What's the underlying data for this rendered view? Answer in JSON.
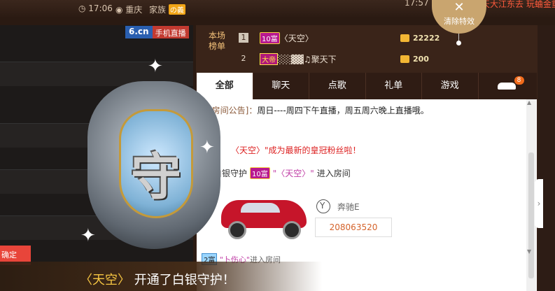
{
  "topbar": {
    "time": "17:06",
    "location": "重庆",
    "family_label": "家族",
    "family_badge": "の義",
    "right_time": "17:57",
    "ticker": "天大江东去 玩蛐金重"
  },
  "video": {
    "brand_site": "6.cn",
    "brand_tag": "手机直播",
    "confirm_label": "确定"
  },
  "leaderboard": {
    "label_line1": "本场",
    "label_line2": "榜单",
    "rows": [
      {
        "rank": "1",
        "badge": "10富",
        "name": "〈天空〉",
        "score": "22222"
      },
      {
        "rank": "2",
        "badge": "大帝",
        "name": "░░▓▓♫聚天下",
        "score": "200"
      }
    ]
  },
  "clear_effects": {
    "icon": "close-icon",
    "label": "清除特效"
  },
  "tabs": {
    "items": [
      "全部",
      "聊天",
      "点歌",
      "礼单",
      "游戏"
    ],
    "active": "全部",
    "car_badge": "8"
  },
  "chat": {
    "notice_label": "[房间公告]：",
    "notice_text": "周日----周四下午直播，周五周六晚上直播哦。",
    "msg1_name": "〈天空〉",
    "msg1_text": "\"成为最新的皇冠粉丝啦！",
    "msg2_prefix": "白银守护",
    "msg2_badge": "10富",
    "msg2_name": "\"〈天空〉\"",
    "msg2_text": "进入房间",
    "car_brand": "奔驰E",
    "car_plate": "208063520",
    "msg3_badge": "2富",
    "msg3_name": "\"卜伤心\"",
    "msg3_text": "进入房间"
  },
  "guardian": {
    "shield_char": "守",
    "banner_name": "〈天空〉",
    "banner_text": "开通了白银守护！"
  },
  "colors": {
    "accent_red": "#e8453a",
    "gold": "#f5c542",
    "panel_brown": "#3a2419"
  }
}
